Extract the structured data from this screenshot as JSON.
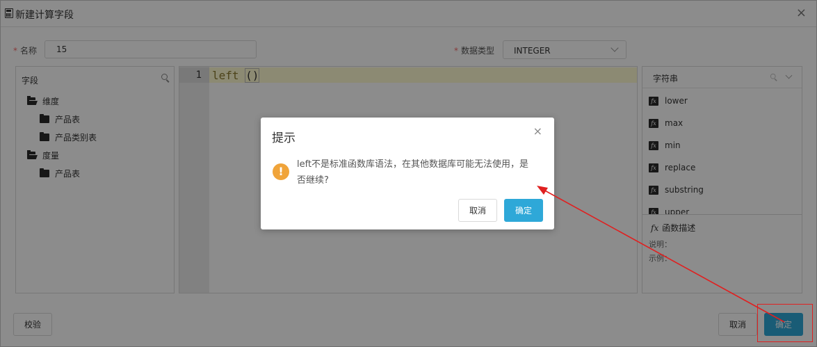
{
  "window": {
    "title": "新建计算字段",
    "close_glyph": "×"
  },
  "form": {
    "name_label": "名称",
    "name_value": "15",
    "type_label": "数据类型",
    "type_value": "INTEGER",
    "required_mark": "*"
  },
  "fields_panel": {
    "title": "字段",
    "tree": [
      {
        "label": "维度",
        "level": 0,
        "open": true
      },
      {
        "label": "产品表",
        "level": 1,
        "open": false
      },
      {
        "label": "产品类别表",
        "level": 1,
        "open": false
      },
      {
        "label": "度量",
        "level": 0,
        "open": true
      },
      {
        "label": "产品表",
        "level": 1,
        "open": false
      }
    ]
  },
  "editor": {
    "line_number": "1",
    "code_text": "left ",
    "code_paren": "()"
  },
  "functions_panel": {
    "title": "字符串",
    "items": [
      "lower",
      "max",
      "min",
      "replace",
      "substring",
      "upper"
    ],
    "fx_glyph": "fx",
    "desc_title": "函数描述",
    "desc_label_1": "说明：",
    "desc_label_2": "示例："
  },
  "footer": {
    "validate_label": "校验",
    "cancel_label": "取消",
    "ok_label": "确定"
  },
  "dialog": {
    "title": "提示",
    "message": "left不是标准函数库语法，在其他数据库可能无法使用，是否继续?",
    "warn_glyph": "!",
    "close_glyph": "×",
    "cancel_label": "取消",
    "ok_label": "确定"
  },
  "colors": {
    "primary": "#2ea8d8",
    "warning": "#f0a43a",
    "annotation": "#e02020",
    "required": "#f56c6c"
  }
}
